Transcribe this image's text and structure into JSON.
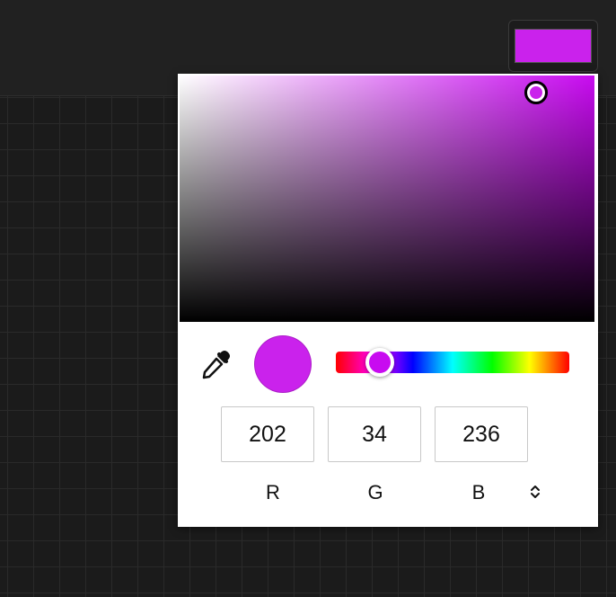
{
  "swatch": {
    "color": "#ca22ec"
  },
  "picker": {
    "hue_color": "#c80bf0",
    "saturation": 0.86,
    "value": 0.93,
    "hue_fraction": 0.19,
    "current_color": "#ca22ec",
    "eyedropper_icon": "eyedropper-icon",
    "mode_toggle_icon": "chevron-up-down-icon",
    "rgb": {
      "r": "202",
      "g": "34",
      "b": "236"
    },
    "labels": {
      "r": "R",
      "g": "G",
      "b": "B"
    }
  }
}
